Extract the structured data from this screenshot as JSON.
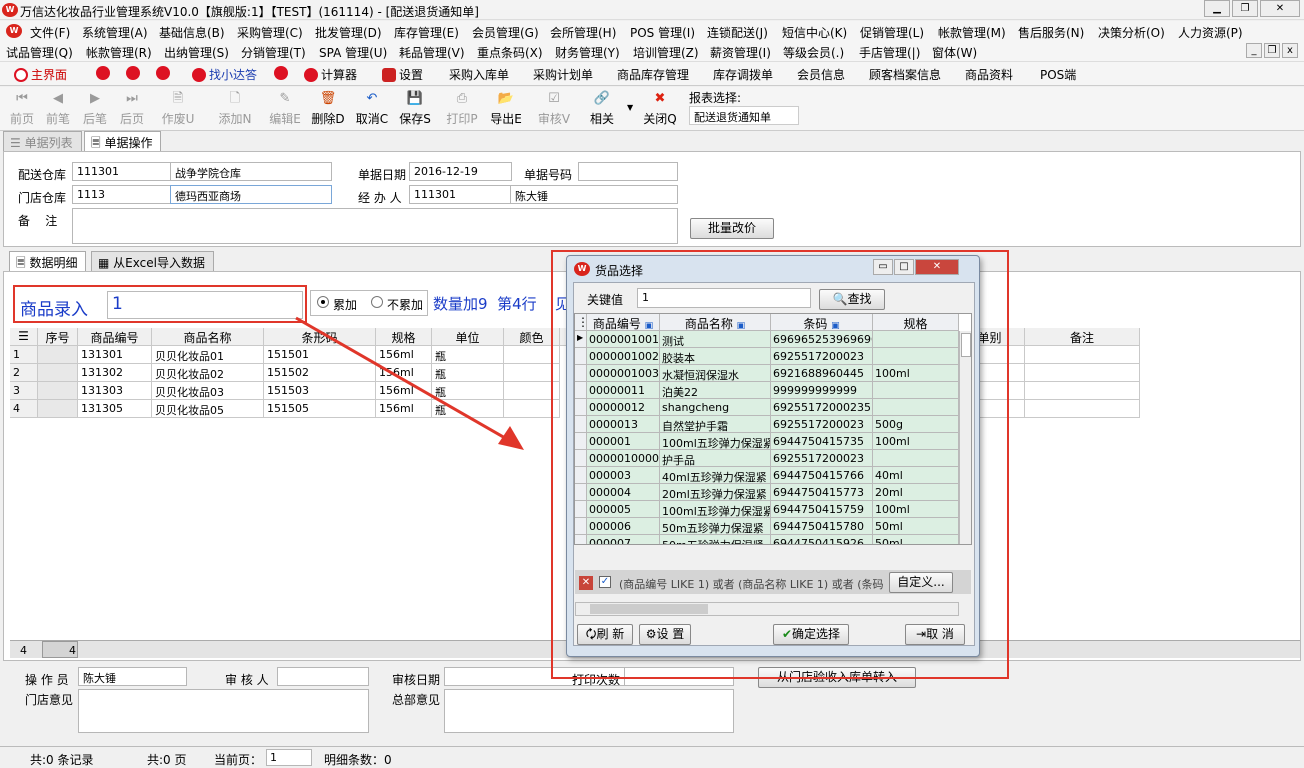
{
  "window": {
    "title": "万信达化妆品行业管理系统V10.0【旗舰版:1】【TEST】(161114) - [配送退货通知单]"
  },
  "menu1": [
    "文件(F)",
    "系统管理(A)",
    "基础信息(B)",
    "采购管理(C)",
    "批发管理(D)",
    "库存管理(E)",
    "会员管理(G)",
    "会所管理(H)",
    "POS 管理(I)",
    "连锁配送(J)",
    "短信中心(K)",
    "促销管理(L)",
    "帐款管理(M)",
    "售后服务(N)",
    "决策分析(O)",
    "人力资源(P)"
  ],
  "menu2": [
    "试品管理(Q)",
    "帐款管理(R)",
    "出纳管理(S)",
    "分销管理(T)",
    "SPA 管理(U)",
    "耗品管理(V)",
    "重点条码(X)",
    "财务管理(Y)",
    "培训管理(Z)",
    "薪资管理(I)",
    "等级会员(.)",
    "手店管理(|)",
    "窗体(W)"
  ],
  "quick": [
    "主界面",
    "找小达答",
    "计算器",
    "设置",
    "采购入库单",
    "采购计划单",
    "商品库存管理",
    "库存调拨单",
    "会员信息",
    "顾客档案信息",
    "商品资料",
    "POS端"
  ],
  "toolbar": {
    "buttons": [
      "前页",
      "前笔",
      "后笔",
      "后页",
      "作废U",
      "添加N",
      "编辑E",
      "删除D",
      "取消C",
      "保存S",
      "打印P",
      "导出E",
      "审核V",
      "相关",
      "关闭Q"
    ],
    "report_label": "报表选择:",
    "report_value": "配送退货通知单"
  },
  "tabs": {
    "list": "单据列表",
    "op": "单据操作",
    "detail": "数据明细",
    "excel": "从Excel导入数据"
  },
  "form": {
    "send_wh_label": "配送仓库",
    "send_wh_code": "111301",
    "send_wh_name": "战争学院仓库",
    "date_label": "单据日期",
    "date": "2016-12-19",
    "no_label": "单据号码",
    "no": "",
    "store_wh_label": "门店仓库",
    "store_wh_code": "1113",
    "store_wh_name": "德玛西亚商场",
    "handler_label": "经 办 人",
    "handler_code": "111301",
    "handler_name": "陈大锤",
    "note_label": "备    注",
    "batch_btn": "批量改价"
  },
  "entry": {
    "label": "商品录入",
    "value": "1",
    "opt1": "累加",
    "opt2": "不累加",
    "info": "数量加9  第4行",
    "more": "见"
  },
  "grid": {
    "headers": [
      "序号",
      "商品编号",
      "商品名称",
      "条形码",
      "规格",
      "单位",
      "颜色",
      "单别",
      "备注"
    ],
    "rows": [
      {
        "no": "1",
        "code": "131301",
        "name": "贝贝化妆品01",
        "bar": "151501",
        "spec": "156ml",
        "unit": "瓶"
      },
      {
        "no": "2",
        "code": "131302",
        "name": "贝贝化妆品02",
        "bar": "151502",
        "spec": "156ml",
        "unit": "瓶"
      },
      {
        "no": "3",
        "code": "131303",
        "name": "贝贝化妆品03",
        "bar": "151503",
        "spec": "156ml",
        "unit": "瓶"
      },
      {
        "no": "4",
        "code": "131305",
        "name": "贝贝化妆品05",
        "bar": "151505",
        "spec": "156ml",
        "unit": "瓶"
      }
    ],
    "footer_count": "4",
    "footer_qty": "4"
  },
  "bottom": {
    "operator_label": "操 作 员",
    "operator": "陈大锤",
    "auditor_label": "审 核 人",
    "audit_date_label": "审核日期",
    "print_label": "打印次数",
    "store_opinion": "门店意见",
    "hq_opinion": "总部意见",
    "transfer_btn": "从门店验收入库单转入"
  },
  "status": {
    "records": "共:0 条记录",
    "pages": "共:0 页",
    "current_label": "当前页：",
    "current": "1",
    "detail_count": "明细条数：0"
  },
  "dialog": {
    "title": "货品选择",
    "key_label": "关键值",
    "key_value": "1",
    "search_btn": "查找",
    "headers": [
      "商品编号",
      "商品名称",
      "条码",
      "规格"
    ],
    "rows": [
      [
        "0000001001",
        "测试",
        "6969652539696969",
        ""
      ],
      [
        "0000001002",
        "胶装本",
        "6925517200023",
        ""
      ],
      [
        "0000001003",
        "水凝恒润保湿水",
        "6921688960445",
        "100ml"
      ],
      [
        "00000011",
        "泊美22",
        "999999999999",
        ""
      ],
      [
        "00000012",
        "shangcheng",
        "69255172000235",
        ""
      ],
      [
        "0000013",
        "自然堂护手霜",
        "6925517200023",
        "500g"
      ],
      [
        "000001",
        "100ml五珍弹力保湿紧",
        "6944750415735",
        "100ml"
      ],
      [
        "00000100000",
        "护手品",
        "6925517200023",
        ""
      ],
      [
        "000003",
        "40ml五珍弹力保湿紧",
        "6944750415766",
        "40ml"
      ],
      [
        "000004",
        "20ml五珍弹力保湿紧",
        "6944750415773",
        "20ml"
      ],
      [
        "000005",
        "100ml五珍弹力保湿紧",
        "6944750415759",
        "100ml"
      ],
      [
        "000006",
        "50m五珍弹力保湿紧",
        "6944750415780",
        "50ml"
      ],
      [
        "000007",
        "50m五珍弹力保湿紧",
        "6944750415926",
        "50ml"
      ]
    ],
    "filter_text": "(商品编号 LIKE 1) 或者 (商品名称 LIKE 1) 或者 (条码",
    "custom_btn": "自定义...",
    "refresh_btn": "刷 新",
    "settings_btn": "设 置",
    "confirm_btn": "确定选择",
    "cancel_btn": "取 消"
  }
}
